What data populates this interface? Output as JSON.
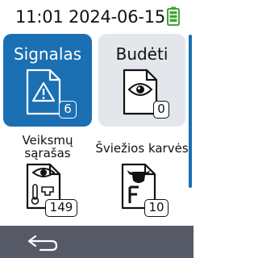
{
  "status": {
    "time": "11:01",
    "date": "2024-06-15",
    "battery_color": "#3fa535"
  },
  "tiles": [
    {
      "label": "Signalas",
      "count": "6",
      "icon": "warning-document-icon",
      "selected": true
    },
    {
      "label": "Budėti",
      "count": "0",
      "icon": "eye-document-icon",
      "selected": false
    },
    {
      "label_line1": "Veiksmų",
      "label_line2": "sąrašas",
      "count": "149",
      "icon": "action-list-document-icon",
      "selected": false
    },
    {
      "label": "Šviežios karvės",
      "count": "10",
      "icon": "fresh-cow-document-icon",
      "selected": false
    }
  ],
  "nav": {
    "back_icon": "back-arrow-icon"
  },
  "colors": {
    "accent": "#1b6fb3",
    "bottom_bar": "#555a66",
    "tile_bg": "#e3e7ec"
  }
}
